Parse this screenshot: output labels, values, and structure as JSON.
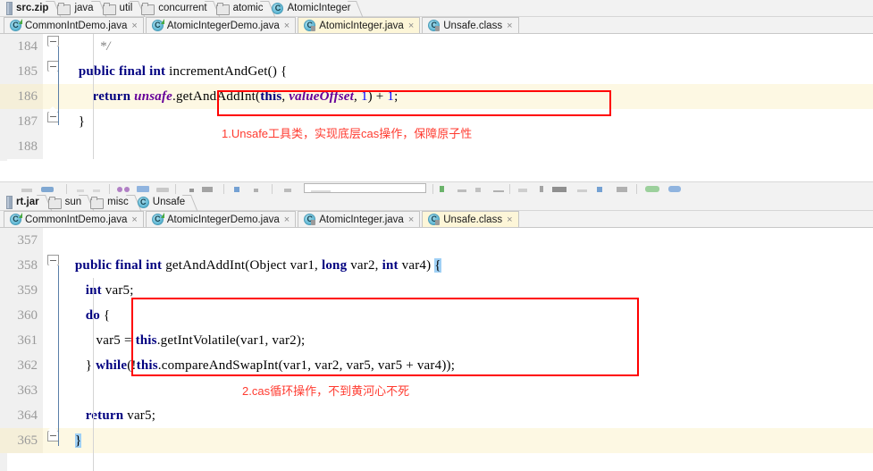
{
  "pane1": {
    "breadcrumb": [
      {
        "label": "src.zip",
        "icon": "module-icon",
        "root": true
      },
      {
        "label": "java",
        "icon": "folder-icon"
      },
      {
        "label": "util",
        "icon": "folder-icon"
      },
      {
        "label": "concurrent",
        "icon": "folder-icon"
      },
      {
        "label": "atomic",
        "icon": "folder-icon"
      },
      {
        "label": "AtomicInteger",
        "icon": "class-icon"
      }
    ],
    "tabs": [
      {
        "label": "CommonIntDemo.java",
        "icon": "java-class-icon",
        "active": false,
        "close": "×"
      },
      {
        "label": "AtomicIntegerDemo.java",
        "icon": "java-class-icon",
        "active": false,
        "close": "×"
      },
      {
        "label": "AtomicInteger.java",
        "icon": "decompiled-class-icon",
        "active": true,
        "close": "×"
      },
      {
        "label": "Unsafe.class",
        "icon": "decompiled-class-icon",
        "active": false,
        "close": "×"
      }
    ],
    "lines": [
      {
        "num": "184",
        "highlight": false,
        "tokens": [
          {
            "t": "          ",
            "c": "pln"
          },
          {
            "t": "*/",
            "c": "cmt"
          }
        ]
      },
      {
        "num": "185",
        "highlight": false,
        "tokens": [
          {
            "t": "    ",
            "c": "pln"
          },
          {
            "t": "public final int",
            "c": "kw"
          },
          {
            "t": " incrementAndGet() {",
            "c": "pln"
          }
        ]
      },
      {
        "num": "186",
        "highlight": true,
        "tokens": [
          {
            "t": "        ",
            "c": "pln"
          },
          {
            "t": "return",
            "c": "kw"
          },
          {
            "t": " ",
            "c": "pln"
          },
          {
            "t": "unsafe",
            "c": "fld"
          },
          {
            "t": ".getAndAddInt(",
            "c": "pln"
          },
          {
            "t": "this",
            "c": "kw"
          },
          {
            "t": ", ",
            "c": "pln"
          },
          {
            "t": "valueOffset",
            "c": "fld"
          },
          {
            "t": ", ",
            "c": "pln"
          },
          {
            "t": "1",
            "c": "num"
          },
          {
            "t": ") + ",
            "c": "pln"
          },
          {
            "t": "1",
            "c": "num"
          },
          {
            "t": ";",
            "c": "pln"
          }
        ]
      },
      {
        "num": "187",
        "highlight": false,
        "tokens": [
          {
            "t": "    }",
            "c": "pln"
          }
        ]
      },
      {
        "num": "188",
        "highlight": false,
        "tokens": [
          {
            "t": "",
            "c": "pln"
          }
        ]
      }
    ],
    "annotation": "1.Unsafe工具类，实现底层cas操作，保障原子性"
  },
  "pane2": {
    "breadcrumb": [
      {
        "label": "rt.jar",
        "icon": "module-icon",
        "root": true
      },
      {
        "label": "sun",
        "icon": "folder-icon"
      },
      {
        "label": "misc",
        "icon": "folder-icon"
      },
      {
        "label": "Unsafe",
        "icon": "class-icon"
      }
    ],
    "tabs": [
      {
        "label": "CommonIntDemo.java",
        "icon": "java-class-icon",
        "active": false,
        "close": "×"
      },
      {
        "label": "AtomicIntegerDemo.java",
        "icon": "java-class-icon",
        "active": false,
        "close": "×"
      },
      {
        "label": "AtomicInteger.java",
        "icon": "decompiled-class-icon",
        "active": false,
        "close": "×"
      },
      {
        "label": "Unsafe.class",
        "icon": "decompiled-class-icon",
        "active": true,
        "close": "×"
      }
    ],
    "lines": [
      {
        "num": "357",
        "highlight": false,
        "tokens": [
          {
            "t": "",
            "c": "pln"
          }
        ]
      },
      {
        "num": "358",
        "highlight": false,
        "tokens": [
          {
            "t": "   ",
            "c": "pln"
          },
          {
            "t": "public final int",
            "c": "kw"
          },
          {
            "t": " getAndAddInt(Object var1, ",
            "c": "pln"
          },
          {
            "t": "long",
            "c": "kw"
          },
          {
            "t": " var2, ",
            "c": "pln"
          },
          {
            "t": "int",
            "c": "kw"
          },
          {
            "t": " var4) ",
            "c": "pln"
          },
          {
            "t": "{",
            "c": "brhl"
          }
        ]
      },
      {
        "num": "359",
        "highlight": false,
        "tokens": [
          {
            "t": "      ",
            "c": "pln"
          },
          {
            "t": "int",
            "c": "kw"
          },
          {
            "t": " var5;",
            "c": "pln"
          }
        ]
      },
      {
        "num": "360",
        "highlight": false,
        "tokens": [
          {
            "t": "      ",
            "c": "pln"
          },
          {
            "t": "do",
            "c": "kw"
          },
          {
            "t": " {",
            "c": "pln"
          }
        ]
      },
      {
        "num": "361",
        "highlight": false,
        "tokens": [
          {
            "t": "         var5 = ",
            "c": "pln"
          },
          {
            "t": "this",
            "c": "kw"
          },
          {
            "t": ".getIntVolatile(var1, var2);",
            "c": "pln"
          }
        ]
      },
      {
        "num": "362",
        "highlight": false,
        "tokens": [
          {
            "t": "      } ",
            "c": "pln"
          },
          {
            "t": "while",
            "c": "kw"
          },
          {
            "t": "(!",
            "c": "pln"
          },
          {
            "t": "this",
            "c": "kw"
          },
          {
            "t": ".compareAndSwapInt(var1, var2, var5, var5 + var4));",
            "c": "pln"
          }
        ]
      },
      {
        "num": "363",
        "highlight": false,
        "tokens": [
          {
            "t": "",
            "c": "pln"
          }
        ]
      },
      {
        "num": "364",
        "highlight": false,
        "tokens": [
          {
            "t": "      ",
            "c": "pln"
          },
          {
            "t": "return",
            "c": "kw"
          },
          {
            "t": " var5;",
            "c": "pln"
          }
        ]
      },
      {
        "num": "365",
        "highlight": true,
        "tokens": [
          {
            "t": "   ",
            "c": "pln"
          },
          {
            "t": "}",
            "c": "brhl"
          }
        ]
      }
    ],
    "annotation": "2.cas循环操作，不到黄河心不死"
  },
  "colors": {
    "annotation_red": "#ff3b30",
    "box_red": "#ff0000",
    "active_tab": "#fdf6d8",
    "line_highlight": "#fdf8e3",
    "keyword": "#000080",
    "field": "#660099",
    "number": "#0000ff",
    "bracket_highlight": "#9fd0f5"
  }
}
